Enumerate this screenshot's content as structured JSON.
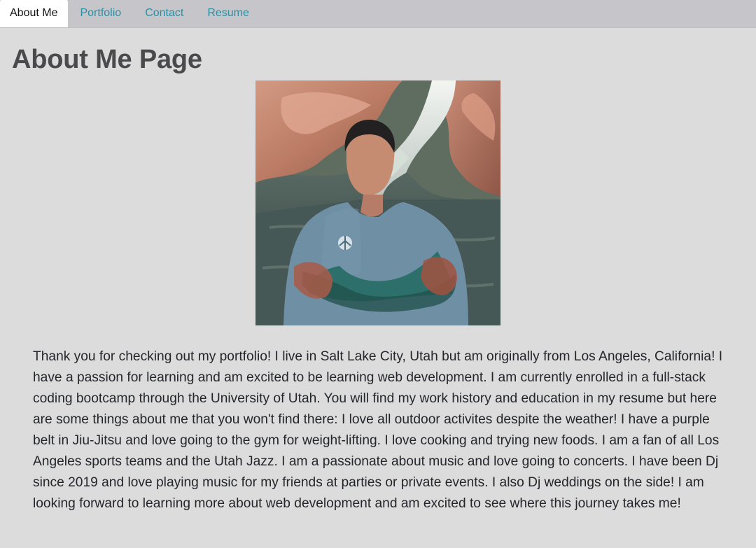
{
  "nav": {
    "tabs": [
      {
        "label": "About Me",
        "active": true
      },
      {
        "label": "Portfolio",
        "active": false
      },
      {
        "label": "Contact",
        "active": false
      },
      {
        "label": "Resume",
        "active": false
      }
    ]
  },
  "page": {
    "title": "About Me Page",
    "bio": "Thank you for checking out my portfolio! I live in Salt Lake City, Utah but am originally from Los Angeles, California! I have a passion for learning and am excited to be learning web development. I am currently enrolled in a full-stack coding bootcamp through the University of Utah. You will find my work history and education in my resume but here are some things about me that you won't find there: I love all outdoor activites despite the weather! I have a purple belt in Jiu-Jitsu and love going to the gym for weight-lifting. I love cooking and trying new foods. I am a fan of all Los Angeles sports teams and the Utah Jazz. I am a passionate about music and love going to concerts. I have been Dj since 2019 and love playing music for my friends at parties or private events. I also Dj weddings on the side! I am looking forward to learning more about web development and am excited to see where this journey takes me!"
  },
  "colors": {
    "page_background": "#dcdcdd",
    "tab_bar": "#c6c5c9",
    "tab_link": "#2b8fa6",
    "active_tab": "#ffffff",
    "heading": "#4a4a4d"
  }
}
